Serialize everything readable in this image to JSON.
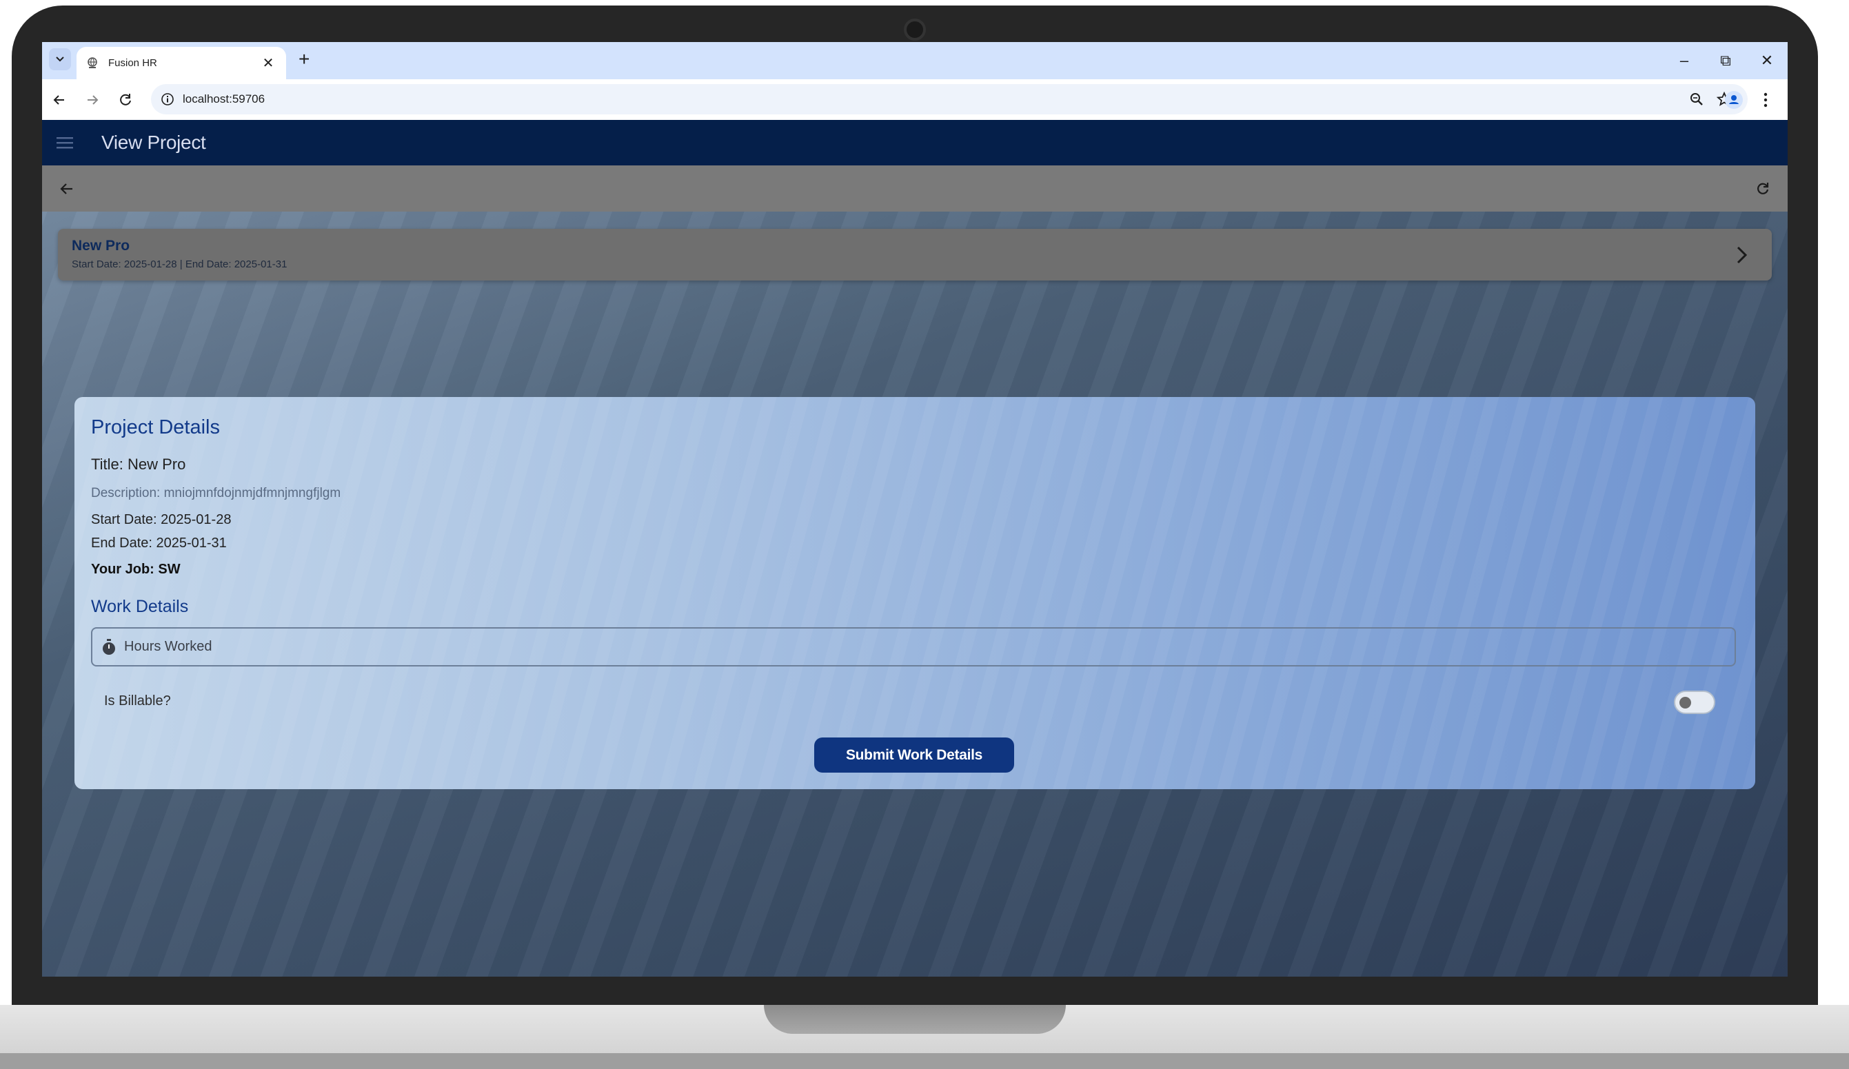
{
  "browser": {
    "tab_title": "Fusion HR",
    "url": "localhost:59706",
    "new_tab": "+",
    "close_tab": "✕",
    "minimize": "–",
    "restore": "⧉",
    "close_window": "✕"
  },
  "app": {
    "title": "View Project",
    "colors": {
      "appbar": "#051f4a",
      "primary_button": "#0f3580",
      "heading": "#123a8a"
    }
  },
  "project_card": {
    "name": "New Pro",
    "dates": "Start Date: 2025-01-28 | End Date: 2025-01-31"
  },
  "details": {
    "heading": "Project Details",
    "title": "Title: New Pro",
    "description": "Description: mniojmnfdojnmjdfmnjmngfjlgm",
    "start_date": "Start Date: 2025-01-28",
    "end_date": "End Date: 2025-01-31",
    "your_job": "Your Job: SW"
  },
  "work_details": {
    "heading": "Work Details",
    "hours_placeholder": "Hours Worked",
    "billable_label": "Is Billable?",
    "billable_on": false,
    "submit_label": "Submit Work Details"
  },
  "icons": [
    "tab-search-icon",
    "globe-icon",
    "back-icon",
    "forward-icon",
    "reload-icon",
    "info-icon",
    "zoom-icon",
    "star-icon",
    "profile-icon",
    "more-vert-icon",
    "hamburger-icon",
    "arrow-back-icon",
    "refresh-icon",
    "chevron-right-icon",
    "timer-icon"
  ]
}
